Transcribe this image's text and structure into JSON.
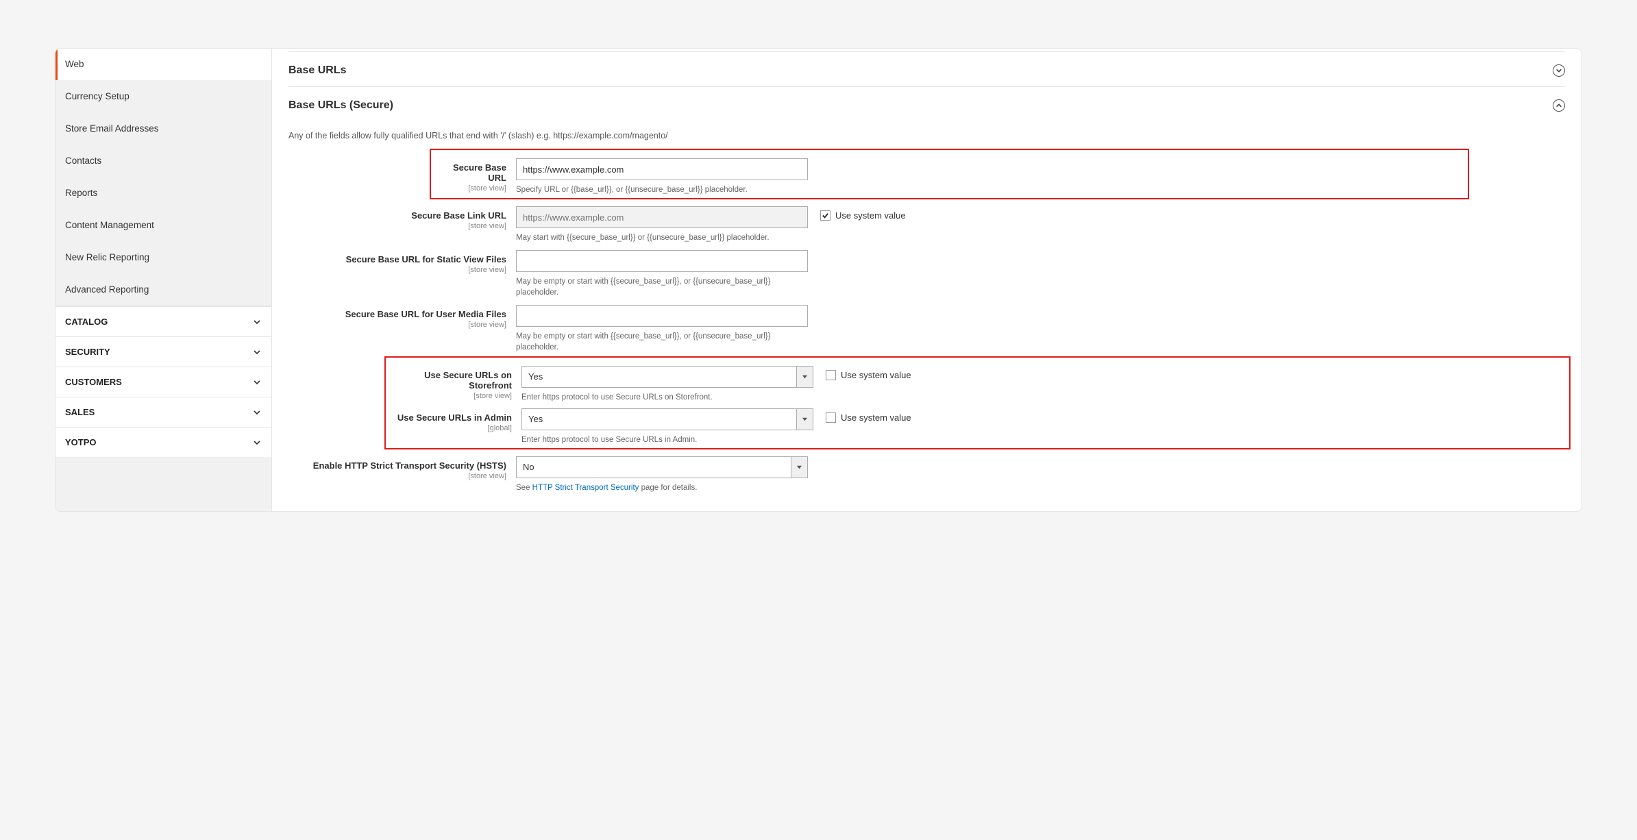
{
  "sidebar": {
    "sub_items": [
      {
        "label": "Web",
        "active": true
      },
      {
        "label": "Currency Setup"
      },
      {
        "label": "Store Email Addresses"
      },
      {
        "label": "Contacts"
      },
      {
        "label": "Reports"
      },
      {
        "label": "Content Management"
      },
      {
        "label": "New Relic Reporting"
      },
      {
        "label": "Advanced Reporting"
      }
    ],
    "categories": [
      {
        "label": "CATALOG"
      },
      {
        "label": "SECURITY"
      },
      {
        "label": "CUSTOMERS"
      },
      {
        "label": "SALES"
      },
      {
        "label": "YOTPO"
      }
    ]
  },
  "sections": {
    "base_urls": {
      "title": "Base URLs"
    },
    "base_urls_secure": {
      "title": "Base URLs (Secure)",
      "note": "Any of the fields allow fully qualified URLs that end with '/' (slash) e.g. https://example.com/magento/"
    }
  },
  "fields": {
    "secure_base_url": {
      "label": "Secure Base URL",
      "scope": "[store view]",
      "value": "https://www.example.com",
      "hint": "Specify URL or {{base_url}}, or {{unsecure_base_url}} placeholder."
    },
    "secure_base_link_url": {
      "label": "Secure Base Link URL",
      "scope": "[store view]",
      "placeholder": "https://www.example.com",
      "hint": "May start with {{secure_base_url}} or {{unsecure_base_url}} placeholder.",
      "use_system_label": "Use system value",
      "use_system_checked": true
    },
    "secure_static": {
      "label": "Secure Base URL for Static View Files",
      "scope": "[store view]",
      "hint": "May be empty or start with {{secure_base_url}}, or {{unsecure_base_url}} placeholder."
    },
    "secure_media": {
      "label": "Secure Base URL for User Media Files",
      "scope": "[store view]",
      "hint": "May be empty or start with {{secure_base_url}}, or {{unsecure_base_url}} placeholder."
    },
    "secure_storefront": {
      "label": "Use Secure URLs on Storefront",
      "scope": "[store view]",
      "value": "Yes",
      "hint": "Enter https protocol to use Secure URLs on Storefront.",
      "use_system_label": "Use system value"
    },
    "secure_admin": {
      "label": "Use Secure URLs in Admin",
      "scope": "[global]",
      "value": "Yes",
      "hint": "Enter https protocol to use Secure URLs in Admin.",
      "use_system_label": "Use system value"
    },
    "hsts": {
      "label": "Enable HTTP Strict Transport Security (HSTS)",
      "scope": "[store view]",
      "value": "No",
      "hint_pre": "See ",
      "hint_link": "HTTP Strict Transport Security",
      "hint_post": " page for details."
    }
  }
}
